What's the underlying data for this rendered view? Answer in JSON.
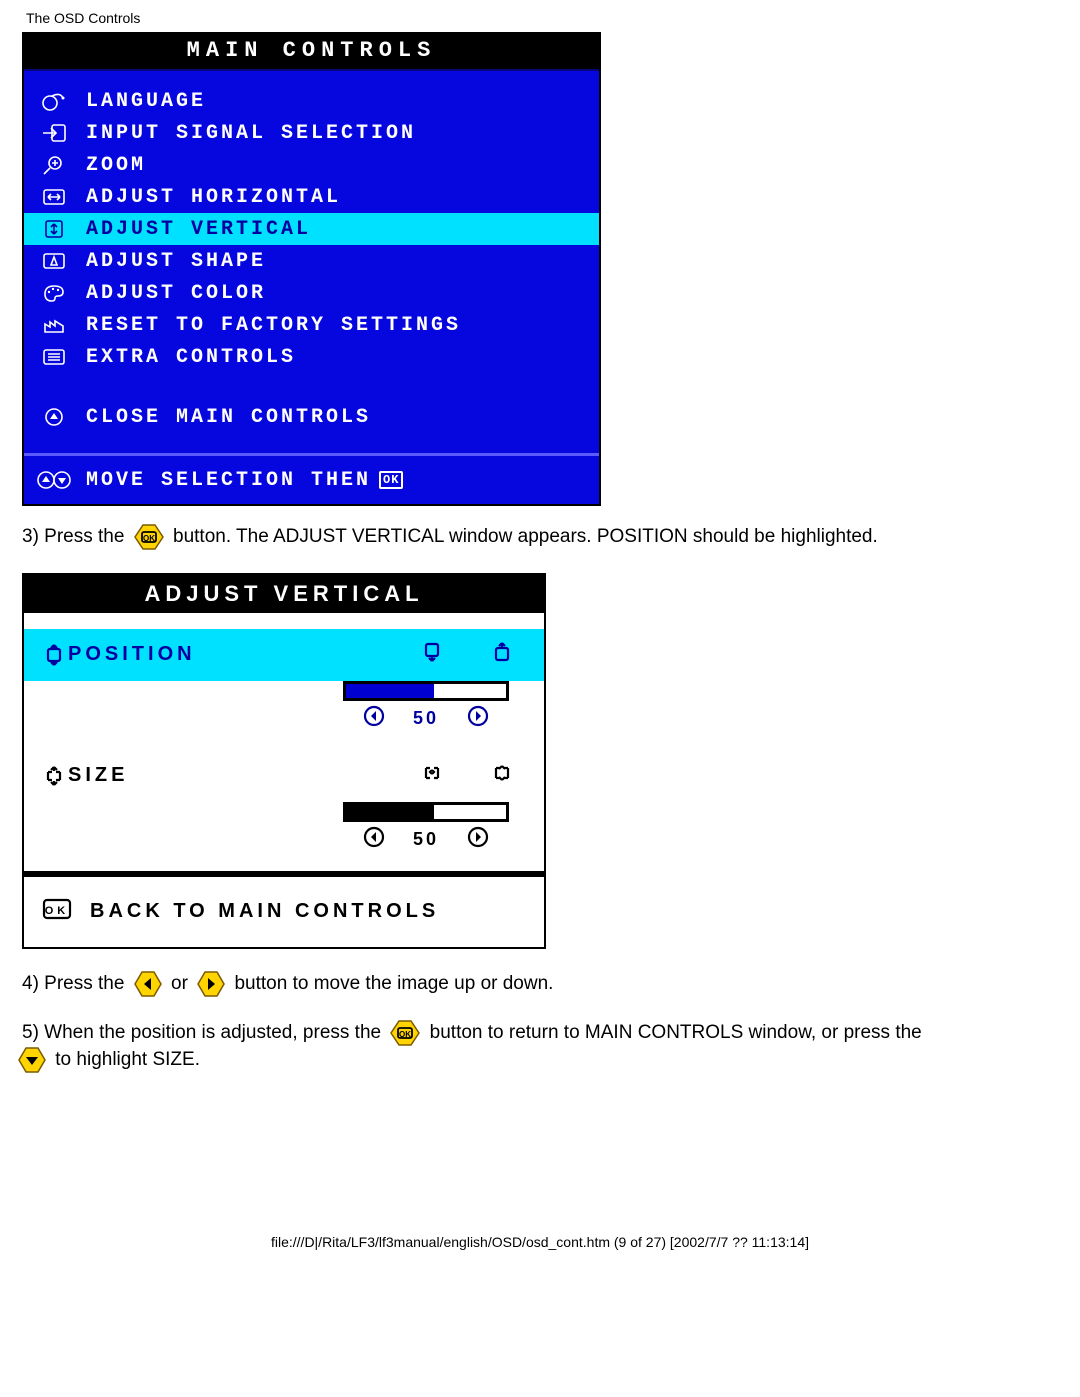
{
  "header": "The OSD Controls",
  "main_controls": {
    "title": "MAIN CONTROLS",
    "items": [
      {
        "icon": "language-icon",
        "label": "LANGUAGE",
        "selected": false
      },
      {
        "icon": "input-icon",
        "label": "INPUT SIGNAL SELECTION",
        "selected": false
      },
      {
        "icon": "zoom-icon",
        "label": "ZOOM",
        "selected": false
      },
      {
        "icon": "adjust-h-icon",
        "label": "ADJUST HORIZONTAL",
        "selected": false
      },
      {
        "icon": "adjust-v-icon",
        "label": "ADJUST VERTICAL",
        "selected": true
      },
      {
        "icon": "shape-icon",
        "label": "ADJUST SHAPE",
        "selected": false
      },
      {
        "icon": "color-icon",
        "label": "ADJUST COLOR",
        "selected": false
      },
      {
        "icon": "factory-icon",
        "label": "RESET TO FACTORY SETTINGS",
        "selected": false
      },
      {
        "icon": "extra-icon",
        "label": "EXTRA CONTROLS",
        "selected": false
      }
    ],
    "close_label": "CLOSE MAIN CONTROLS",
    "footer_label": "MOVE SELECTION THEN"
  },
  "step3": {
    "pre": "3) Press the ",
    "post": " button. The ADJUST VERTICAL window appears. POSITION should be highlighted."
  },
  "adjust_vertical": {
    "title": "ADJUST VERTICAL",
    "position_label": "POSITION",
    "position_value": "50",
    "position_fill_pct": 55,
    "position_fill_color": "#0000d0",
    "size_label": "SIZE",
    "size_value": "50",
    "size_fill_pct": 55,
    "size_fill_color": "#000",
    "back_label": "BACK TO MAIN CONTROLS"
  },
  "step4": {
    "pre": "4) Press the ",
    "mid": " or ",
    "post": " button to move the image up or down."
  },
  "step5": {
    "pre": "5) When the position is adjusted, press the ",
    "mid": " button to return to MAIN CONTROLS window, or press the",
    "post": " to highlight SIZE."
  },
  "footer": "file:///D|/Rita/LF3/lf3manual/english/OSD/osd_cont.htm (9 of 27) [2002/7/7 ?? 11:13:14]"
}
